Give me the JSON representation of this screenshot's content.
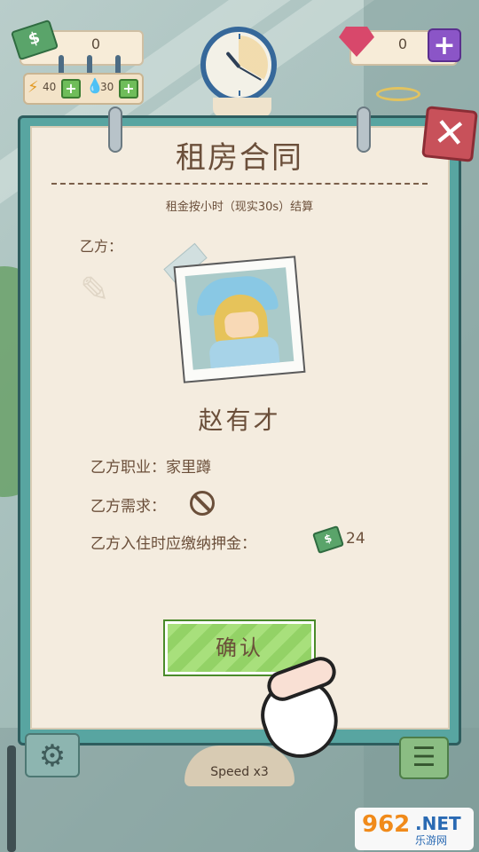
{
  "hud": {
    "money": "0",
    "money_icon": "$",
    "energy": "40",
    "water": "30",
    "gems": "0"
  },
  "contract": {
    "title": "租房合同",
    "subtitle": "租金按小时（现实30s）结算",
    "party_b_label": "乙方：",
    "tenant_name": "赵有才",
    "occupation": "乙方职业：家里蹲",
    "needs_label": "乙方需求：",
    "deposit_label": "乙方入住时应缴纳押金：",
    "deposit_amount": "24",
    "confirm_label": "确认"
  },
  "footer": {
    "speed_label": "Speed x3"
  },
  "watermark": {
    "logo": "962",
    "net": ".NET",
    "site": "乐游网"
  },
  "colors": {
    "board": "#58a5a1",
    "paper": "#f4ecdf",
    "text": "#6b4f3a",
    "confirm": "#a8e07c",
    "close": "#c8515a",
    "gem_plus": "#8b55c7"
  },
  "icons": [
    "money-icon",
    "energy-icon",
    "water-icon",
    "gem-icon",
    "plus-icon",
    "clock-icon",
    "close-icon",
    "no-entry-icon",
    "settings-icon",
    "list-icon",
    "hand-cursor-icon"
  ]
}
